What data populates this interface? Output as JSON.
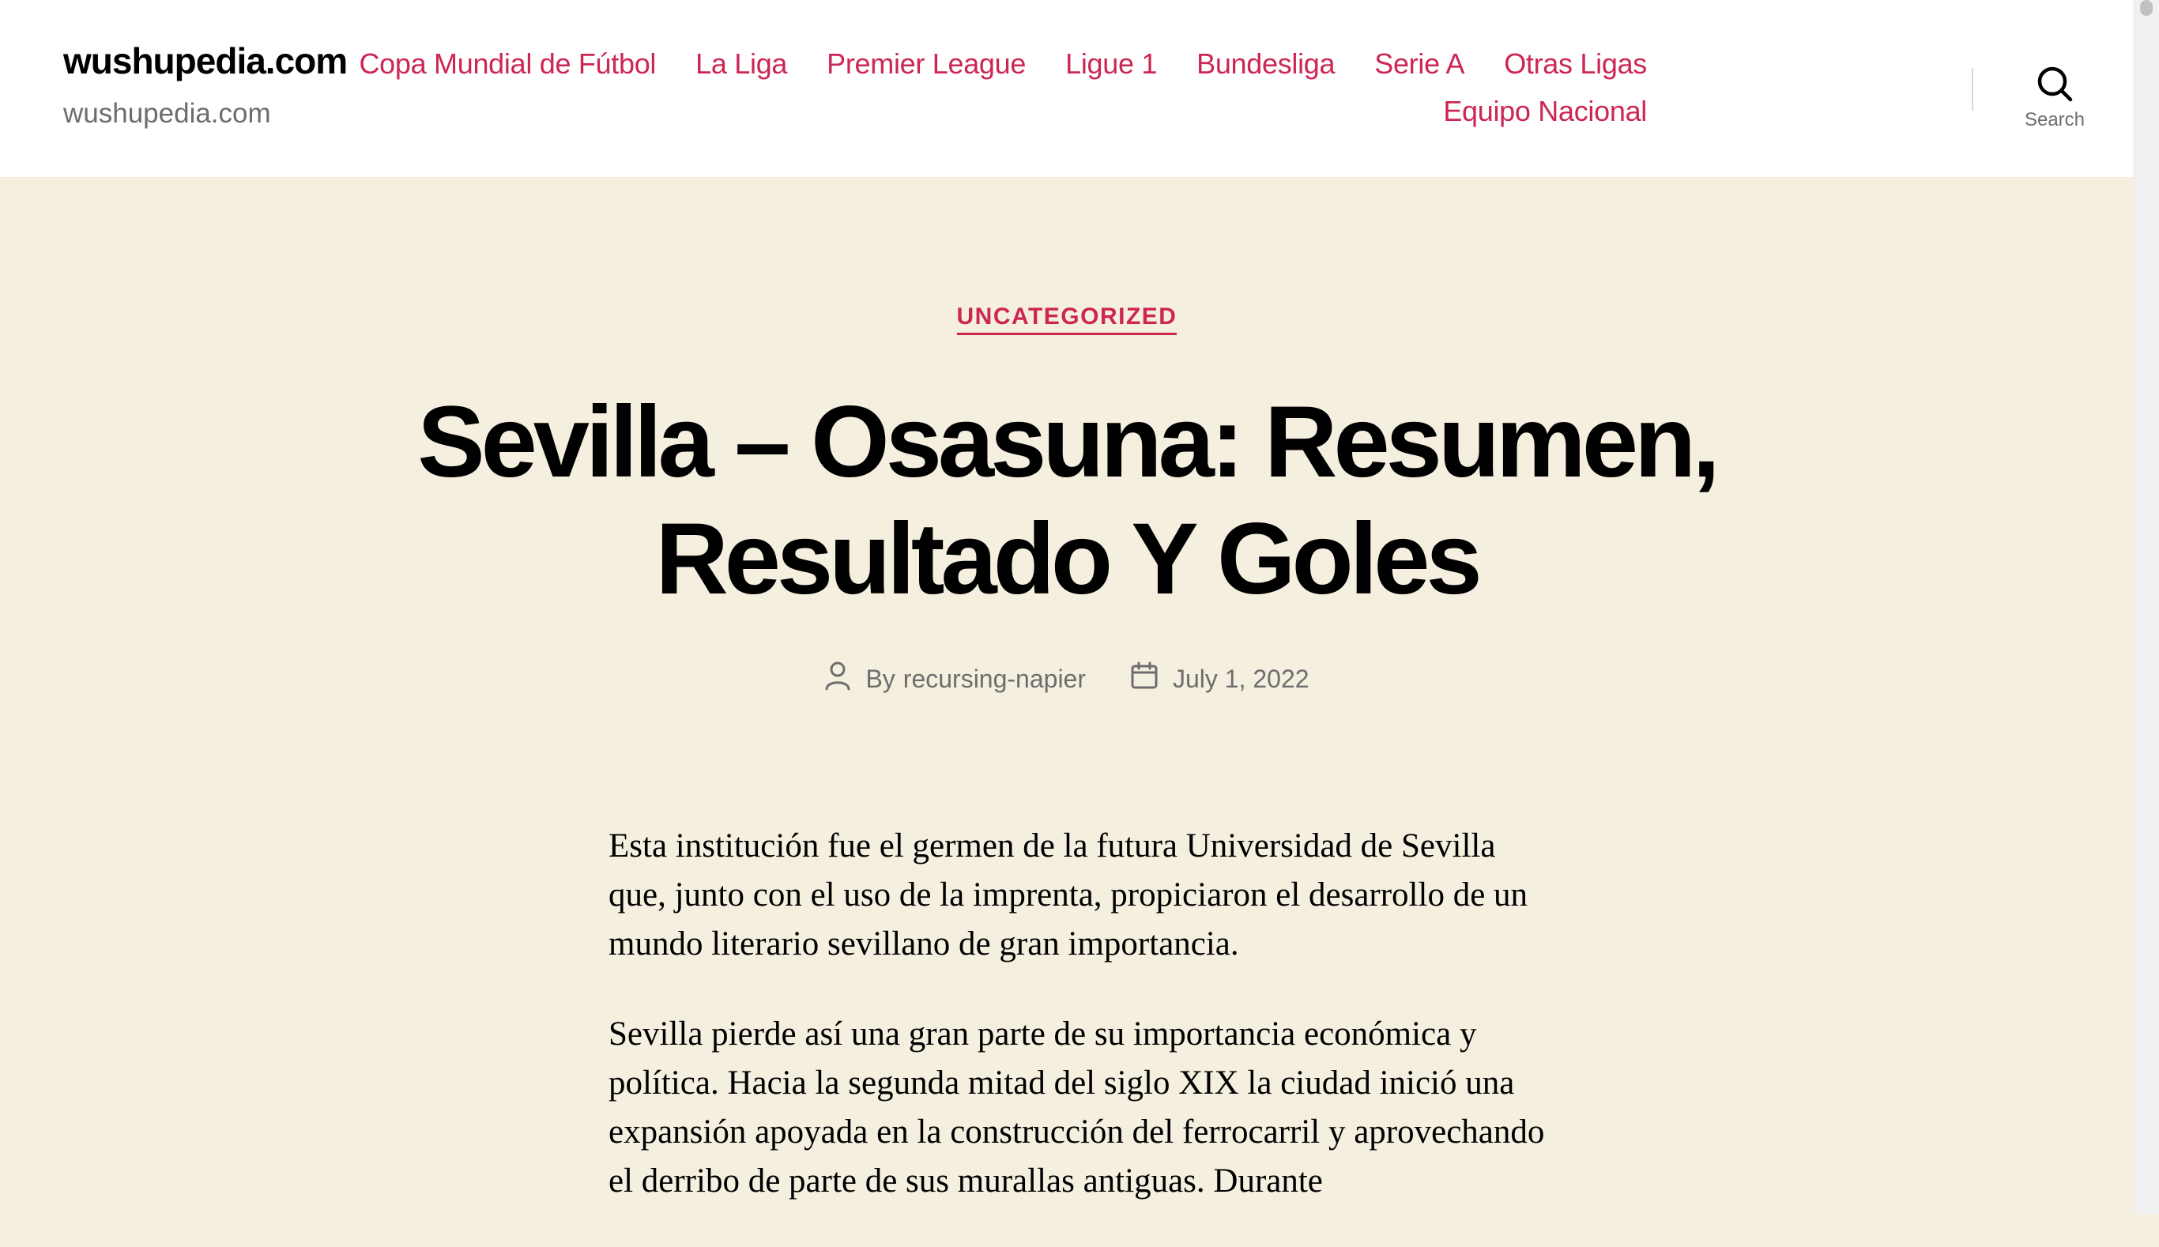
{
  "header": {
    "site_title": "wushupedia.com",
    "site_description": "wushupedia.com",
    "menu": [
      "Copa Mundial de Fútbol",
      "La Liga",
      "Premier League",
      "Ligue 1",
      "Bundesliga",
      "Serie A",
      "Otras Ligas",
      "Equipo Nacional"
    ],
    "search_label": "Search",
    "search_icon": "search-icon"
  },
  "post": {
    "category": "UNCATEGORIZED",
    "title": "Sevilla – Osasuna: Resumen, Resultado Y Goles",
    "author_prefix": "By",
    "author": "recursing-napier",
    "author_icon": "user-icon",
    "date": "July 1, 2022",
    "date_icon": "calendar-icon",
    "paragraphs": [
      "Esta institución fue el germen de la futura Universidad de Sevilla que, junto con el uso de la imprenta, propiciaron el desarrollo de un mundo literario sevillano de gran importancia.",
      "Sevilla pierde así una gran parte de su importancia económica y política. Hacia la segunda mitad del siglo XIX la ciudad inició una expansión apoyada en la construcción del ferrocarril y aprovechando el derribo de parte de sus murallas antiguas. Durante"
    ]
  },
  "colors": {
    "accent": "#cd2653",
    "background": "#f5efe0",
    "header_background": "#ffffff",
    "secondary_text": "#6d6d6d"
  }
}
